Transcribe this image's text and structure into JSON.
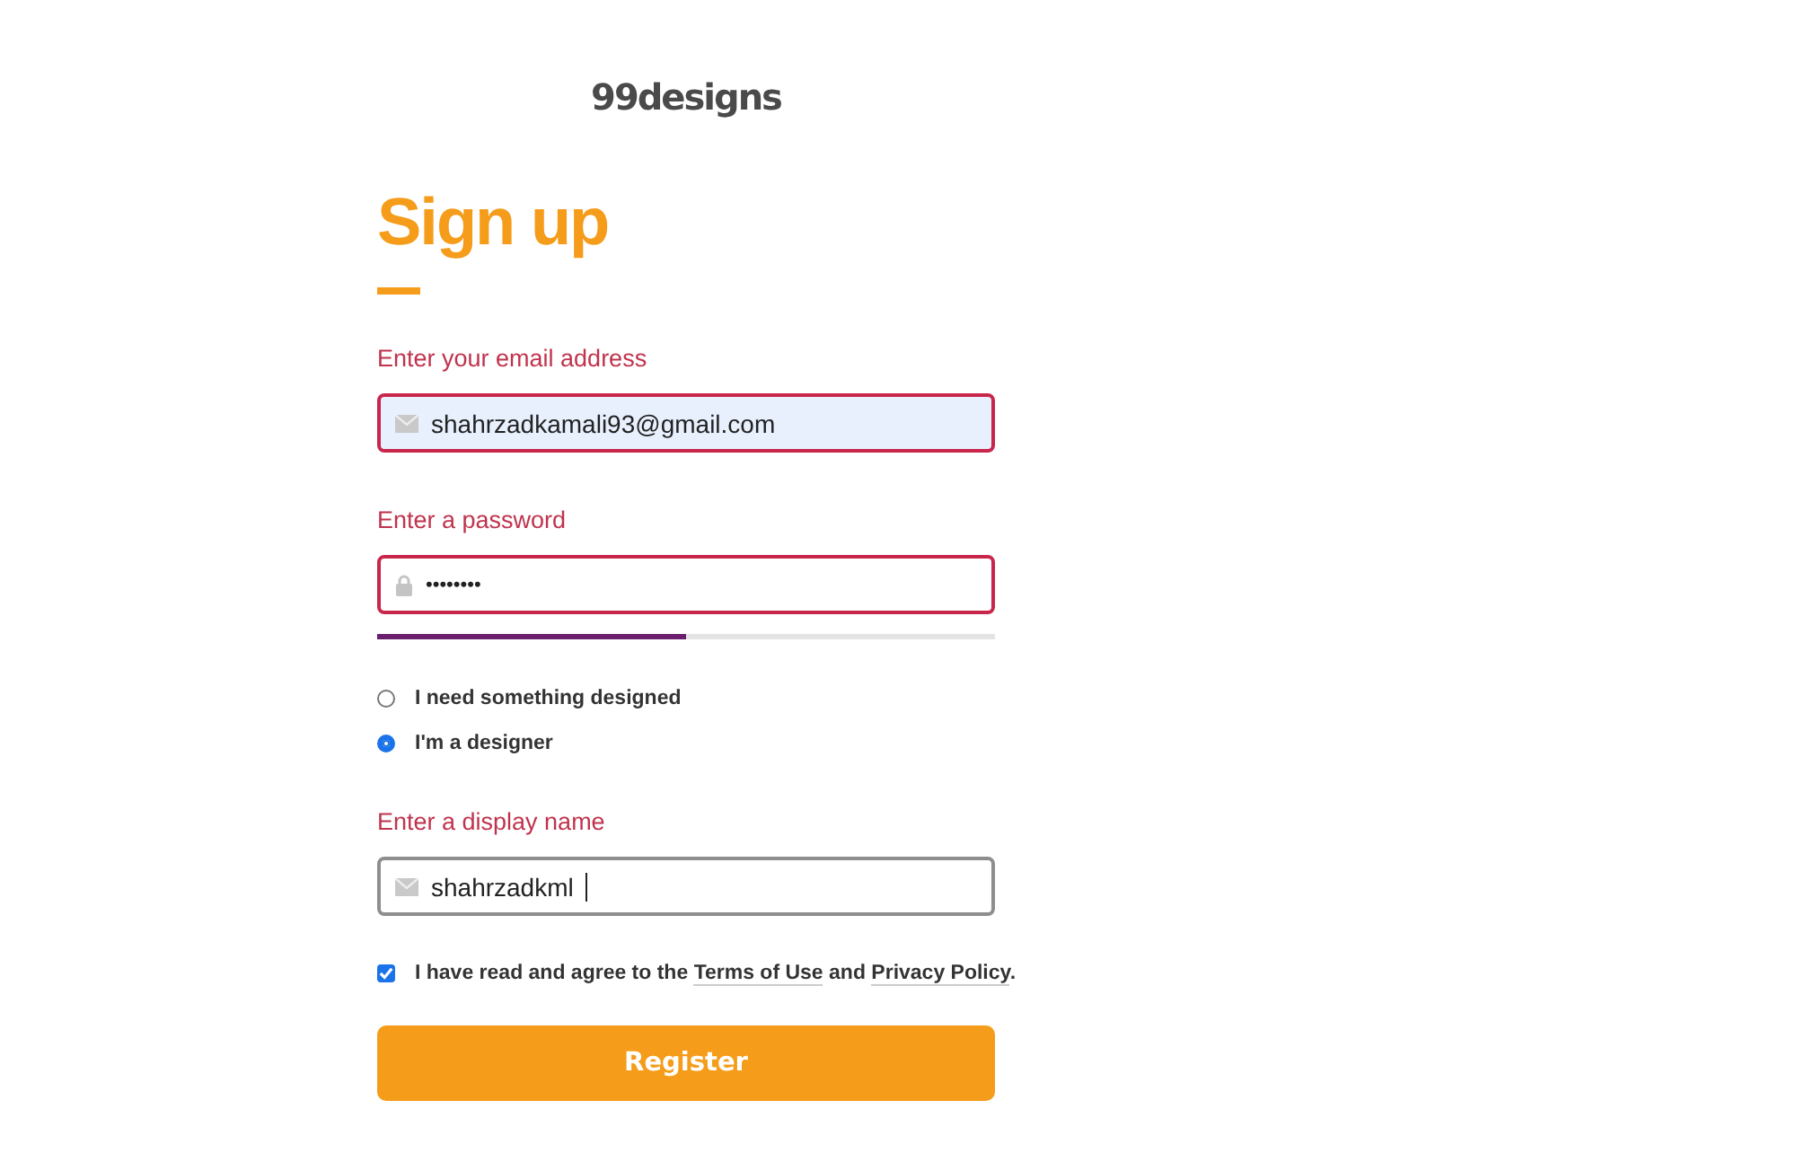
{
  "logo": "99designs",
  "title": "Sign up",
  "email": {
    "label": "Enter your email address",
    "value": "shahrzadkamali93@gmail.com",
    "invalid": true,
    "autofilled": true
  },
  "password": {
    "label": "Enter a password",
    "value": "••••••••",
    "invalid": true,
    "strength": {
      "level": 0.5
    }
  },
  "role_options": [
    {
      "label": "I need something designed",
      "selected": false
    },
    {
      "label": "I'm a designer",
      "selected": true
    }
  ],
  "display_name": {
    "label": "Enter a display name",
    "value": "shahrzadkml",
    "invalid": false
  },
  "agreement": {
    "checked": true,
    "text_before": "I have read and agree to the",
    "terms_link": "Terms of Use",
    "text_middle": "and",
    "privacy_link": "Privacy Policy",
    "text_after": "."
  },
  "register_button": "Register"
}
